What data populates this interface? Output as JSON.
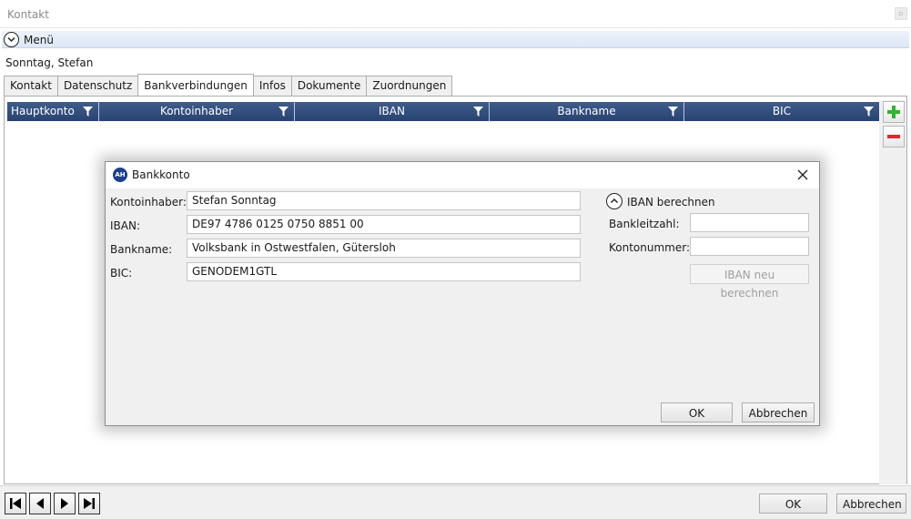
{
  "window": {
    "title": "Kontakt"
  },
  "menu": {
    "label": "Menü"
  },
  "contact": {
    "name": "Sonntag, Stefan"
  },
  "tabs": [
    {
      "label": "Kontakt"
    },
    {
      "label": "Datenschutz"
    },
    {
      "label": "Bankverbindungen",
      "active": true
    },
    {
      "label": "Infos"
    },
    {
      "label": "Dokumente"
    },
    {
      "label": "Zuordnungen"
    }
  ],
  "grid": {
    "columns": [
      "Hauptkonto",
      "Kontoinhaber",
      "IBAN",
      "Bankname",
      "BIC"
    ]
  },
  "footer": {
    "ok_label": "OK",
    "cancel_label": "Abbrechen"
  },
  "dialog": {
    "title": "Bankkonto",
    "logo_text": "AH",
    "fields": {
      "kontoinhaber": {
        "label": "Kontoinhaber:",
        "value": "Stefan Sonntag"
      },
      "iban": {
        "label": "IBAN:",
        "value": "DE97 4786 0125 0750 8851 00"
      },
      "bankname": {
        "label": "Bankname:",
        "value": "Volksbank in Ostwestfalen, Gütersloh"
      },
      "bic": {
        "label": "BIC:",
        "value": "GENODEM1GTL"
      }
    },
    "iban_calc": {
      "header": "IBAN berechnen",
      "bankleitzahl_label": "Bankleitzahl:",
      "bankleitzahl_value": "",
      "kontonummer_label": "Kontonummer:",
      "kontonummer_value": "",
      "recalc_label": "IBAN neu berechnen"
    },
    "ok_label": "OK",
    "cancel_label": "Abbrechen"
  },
  "colors": {
    "grid_header": "#2f4b7c",
    "accent_add": "#2fb52f",
    "accent_remove": "#e0262e",
    "logo": "#1b3f8b"
  }
}
